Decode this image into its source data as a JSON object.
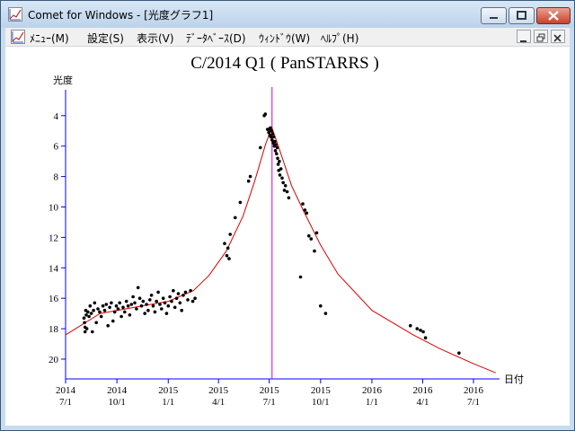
{
  "window": {
    "title": "Comet for Windows - [光度グラフ1]"
  },
  "menu": {
    "items": [
      {
        "label": "ﾒﾆｭｰ(M)"
      },
      {
        "label": "設定(S)"
      },
      {
        "label": "表示(V)"
      },
      {
        "label": "ﾃﾞｰﾀﾍﾞｰｽ(D)"
      },
      {
        "label": "ｳｨﾝﾄﾞｳ(W)"
      },
      {
        "label": "ﾍﾙﾌﾟ(H)"
      }
    ]
  },
  "colors": {
    "axis": "#0000ff",
    "curve": "#dd0000",
    "perihelion_line": "#cc00cc",
    "points": "#000000"
  },
  "chart_data": {
    "type": "scatter",
    "title": "C/2014 Q1 ( PanSTARRS )",
    "ylabel": "光度",
    "xlabel": "日付",
    "y_inverted": true,
    "ylim": [
      2.3,
      21.3
    ],
    "y_ticks": [
      4,
      6,
      8,
      10,
      12,
      14,
      16,
      18,
      20
    ],
    "x_ticks": [
      {
        "date": "2014-07-01",
        "year": "2014",
        "md": "7/1"
      },
      {
        "date": "2014-10-01",
        "year": "2014",
        "md": "10/1"
      },
      {
        "date": "2015-01-01",
        "year": "2015",
        "md": "1/1"
      },
      {
        "date": "2015-04-01",
        "year": "2015",
        "md": "4/1"
      },
      {
        "date": "2015-07-01",
        "year": "2015",
        "md": "7/1"
      },
      {
        "date": "2015-10-01",
        "year": "2015",
        "md": "10/1"
      },
      {
        "date": "2016-01-01",
        "year": "2016",
        "md": "1/1"
      },
      {
        "date": "2016-04-01",
        "year": "2016",
        "md": "4/1"
      },
      {
        "date": "2016-07-01",
        "year": "2016",
        "md": "7/1"
      }
    ],
    "perihelion_date": "2015-07-06",
    "curve": {
      "type": "line",
      "points": [
        [
          "2014-07-01",
          18.4
        ],
        [
          "2014-09-01",
          17.0
        ],
        [
          "2014-11-01",
          16.6
        ],
        [
          "2015-01-01",
          16.2
        ],
        [
          "2015-02-15",
          15.5
        ],
        [
          "2015-03-15",
          14.5
        ],
        [
          "2015-04-15",
          12.9
        ],
        [
          "2015-05-15",
          10.6
        ],
        [
          "2015-06-05",
          8.3
        ],
        [
          "2015-06-25",
          5.8
        ],
        [
          "2015-07-06",
          4.8
        ],
        [
          "2015-07-20",
          6.3
        ],
        [
          "2015-08-10",
          8.6
        ],
        [
          "2015-09-01",
          10.3
        ],
        [
          "2015-10-01",
          12.5
        ],
        [
          "2015-11-01",
          14.4
        ],
        [
          "2016-01-01",
          16.8
        ],
        [
          "2016-03-15",
          18.4
        ],
        [
          "2016-05-01",
          19.3
        ],
        [
          "2016-07-01",
          20.3
        ],
        [
          "2016-08-10",
          20.9
        ]
      ]
    },
    "observations": [
      [
        "2014-08-03",
        17.3
      ],
      [
        "2014-08-04",
        17.6
      ],
      [
        "2014-08-05",
        17.9
      ],
      [
        "2014-08-05",
        18.2
      ],
      [
        "2014-08-06",
        16.8
      ],
      [
        "2014-08-07",
        17.1
      ],
      [
        "2014-08-08",
        18.0
      ],
      [
        "2014-08-10",
        16.9
      ],
      [
        "2014-08-12",
        17.2
      ],
      [
        "2014-08-14",
        16.5
      ],
      [
        "2014-08-16",
        17.0
      ],
      [
        "2014-08-18",
        18.2
      ],
      [
        "2014-08-20",
        16.8
      ],
      [
        "2014-08-22",
        16.3
      ],
      [
        "2014-08-25",
        17.6
      ],
      [
        "2014-08-28",
        16.7
      ],
      [
        "2014-08-31",
        16.9
      ],
      [
        "2014-09-03",
        17.2
      ],
      [
        "2014-09-06",
        16.5
      ],
      [
        "2014-09-09",
        16.8
      ],
      [
        "2014-09-12",
        16.4
      ],
      [
        "2014-09-15",
        17.8
      ],
      [
        "2014-09-18",
        16.6
      ],
      [
        "2014-09-21",
        16.3
      ],
      [
        "2014-09-24",
        17.5
      ],
      [
        "2014-09-27",
        16.9
      ],
      [
        "2014-09-30",
        16.5
      ],
      [
        "2014-10-03",
        16.7
      ],
      [
        "2014-10-06",
        16.3
      ],
      [
        "2014-10-09",
        17.2
      ],
      [
        "2014-10-12",
        16.6
      ],
      [
        "2014-10-15",
        16.9
      ],
      [
        "2014-10-18",
        16.2
      ],
      [
        "2014-10-21",
        16.5
      ],
      [
        "2014-10-24",
        17.1
      ],
      [
        "2014-10-27",
        16.4
      ],
      [
        "2014-10-30",
        15.9
      ],
      [
        "2014-11-02",
        16.3
      ],
      [
        "2014-11-05",
        16.7
      ],
      [
        "2014-11-08",
        15.3
      ],
      [
        "2014-11-11",
        16.0
      ],
      [
        "2014-11-14",
        16.5
      ],
      [
        "2014-11-17",
        16.2
      ],
      [
        "2014-11-20",
        17.0
      ],
      [
        "2014-11-23",
        16.4
      ],
      [
        "2014-11-26",
        16.8
      ],
      [
        "2014-11-29",
        16.1
      ],
      [
        "2014-12-02",
        15.8
      ],
      [
        "2014-12-05",
        16.5
      ],
      [
        "2014-12-08",
        16.9
      ],
      [
        "2014-12-11",
        16.2
      ],
      [
        "2014-12-14",
        15.6
      ],
      [
        "2014-12-17",
        16.4
      ],
      [
        "2014-12-20",
        16.7
      ],
      [
        "2014-12-23",
        16.0
      ],
      [
        "2014-12-26",
        16.3
      ],
      [
        "2014-12-29",
        17.0
      ],
      [
        "2015-01-01",
        16.5
      ],
      [
        "2015-01-04",
        15.9
      ],
      [
        "2015-01-07",
        16.2
      ],
      [
        "2015-01-10",
        15.5
      ],
      [
        "2015-01-13",
        16.6
      ],
      [
        "2015-01-16",
        16.0
      ],
      [
        "2015-01-19",
        15.7
      ],
      [
        "2015-01-22",
        16.3
      ],
      [
        "2015-01-25",
        16.8
      ],
      [
        "2015-01-28",
        15.8
      ],
      [
        "2015-02-01",
        15.6
      ],
      [
        "2015-02-05",
        16.1
      ],
      [
        "2015-02-10",
        15.5
      ],
      [
        "2015-02-14",
        16.2
      ],
      [
        "2015-02-18",
        16.0
      ],
      [
        "2015-04-12",
        12.4
      ],
      [
        "2015-04-16",
        13.2
      ],
      [
        "2015-04-18",
        12.7
      ],
      [
        "2015-04-20",
        13.4
      ],
      [
        "2015-04-22",
        11.8
      ],
      [
        "2015-05-01",
        10.7
      ],
      [
        "2015-05-10",
        9.7
      ],
      [
        "2015-05-25",
        8.3
      ],
      [
        "2015-05-28",
        8.0
      ],
      [
        "2015-06-15",
        6.1
      ],
      [
        "2015-06-22",
        4.0
      ],
      [
        "2015-06-24",
        3.9
      ],
      [
        "2015-06-28",
        4.9
      ],
      [
        "2015-06-30",
        5.1
      ],
      [
        "2015-07-01",
        4.9
      ],
      [
        "2015-07-02",
        5.3
      ],
      [
        "2015-07-03",
        4.8
      ],
      [
        "2015-07-04",
        5.4
      ],
      [
        "2015-07-05",
        5.0
      ],
      [
        "2015-07-06",
        5.6
      ],
      [
        "2015-07-07",
        5.2
      ],
      [
        "2015-07-08",
        5.8
      ],
      [
        "2015-07-09",
        5.4
      ],
      [
        "2015-07-10",
        6.0
      ],
      [
        "2015-07-11",
        5.7
      ],
      [
        "2015-07-12",
        6.3
      ],
      [
        "2015-07-13",
        5.9
      ],
      [
        "2015-07-14",
        6.5
      ],
      [
        "2015-07-15",
        6.1
      ],
      [
        "2015-07-16",
        6.8
      ],
      [
        "2015-07-17",
        7.2
      ],
      [
        "2015-07-18",
        7.6
      ],
      [
        "2015-07-19",
        7.0
      ],
      [
        "2015-07-20",
        7.9
      ],
      [
        "2015-07-22",
        7.5
      ],
      [
        "2015-07-24",
        8.1
      ],
      [
        "2015-07-26",
        8.4
      ],
      [
        "2015-07-28",
        8.9
      ],
      [
        "2015-07-30",
        8.6
      ],
      [
        "2015-08-02",
        9.0
      ],
      [
        "2015-08-05",
        9.4
      ],
      [
        "2015-08-26",
        14.6
      ],
      [
        "2015-08-30",
        9.8
      ],
      [
        "2015-09-03",
        10.2
      ],
      [
        "2015-09-06",
        10.4
      ],
      [
        "2015-09-10",
        11.9
      ],
      [
        "2015-09-14",
        12.1
      ],
      [
        "2015-09-20",
        12.9
      ],
      [
        "2015-09-24",
        11.7
      ],
      [
        "2015-10-01",
        16.5
      ],
      [
        "2015-10-10",
        17.0
      ],
      [
        "2016-03-10",
        17.8
      ],
      [
        "2016-03-22",
        18.0
      ],
      [
        "2016-03-28",
        18.1
      ],
      [
        "2016-04-02",
        18.2
      ],
      [
        "2016-04-06",
        18.6
      ],
      [
        "2016-06-05",
        19.6
      ]
    ]
  }
}
